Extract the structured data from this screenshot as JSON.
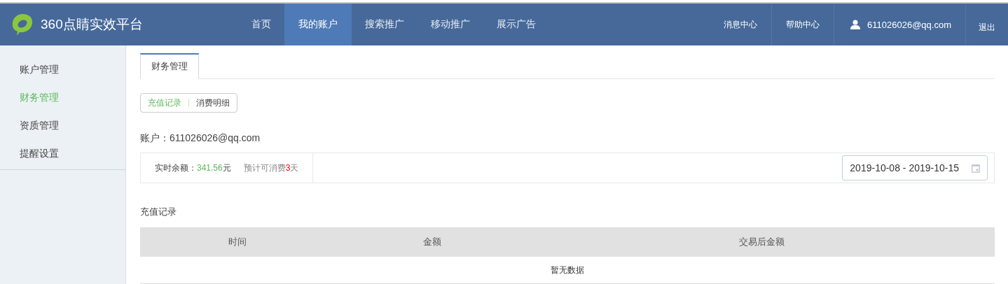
{
  "header": {
    "logo_text": "360点睛实效平台",
    "nav": [
      {
        "label": "首页",
        "selected": false
      },
      {
        "label": "我的账户",
        "selected": true
      },
      {
        "label": "搜索推广",
        "selected": false
      },
      {
        "label": "移动推广",
        "selected": false
      },
      {
        "label": "展示广告",
        "selected": false
      }
    ],
    "links": [
      "消息中心",
      "帮助中心"
    ],
    "user": "611026026@qq.com",
    "logout": "退出"
  },
  "sidebar": {
    "items": [
      {
        "label": "账户管理",
        "selected": false
      },
      {
        "label": "财务管理",
        "selected": true
      },
      {
        "label": "资质管理",
        "selected": false
      },
      {
        "label": "提醒设置",
        "selected": false
      }
    ]
  },
  "tabs": [
    {
      "label": "财务管理",
      "selected": true
    }
  ],
  "segments": [
    {
      "label": "充值记录",
      "selected": true
    },
    {
      "label": "消费明细",
      "selected": false
    }
  ],
  "account": "账户：611026026@qq.com",
  "balance": {
    "label": "实时余额：",
    "amount": "341.56",
    "unit": "元",
    "forecast_prefix": "预计可消费",
    "days": "3",
    "days_unit": "天"
  },
  "date_range": "2019-10-08 - 2019-10-15",
  "section_title": "充值记录",
  "table": {
    "columns": [
      "时间",
      "金额",
      "交易后金额"
    ],
    "empty_text": "暂无数据"
  }
}
